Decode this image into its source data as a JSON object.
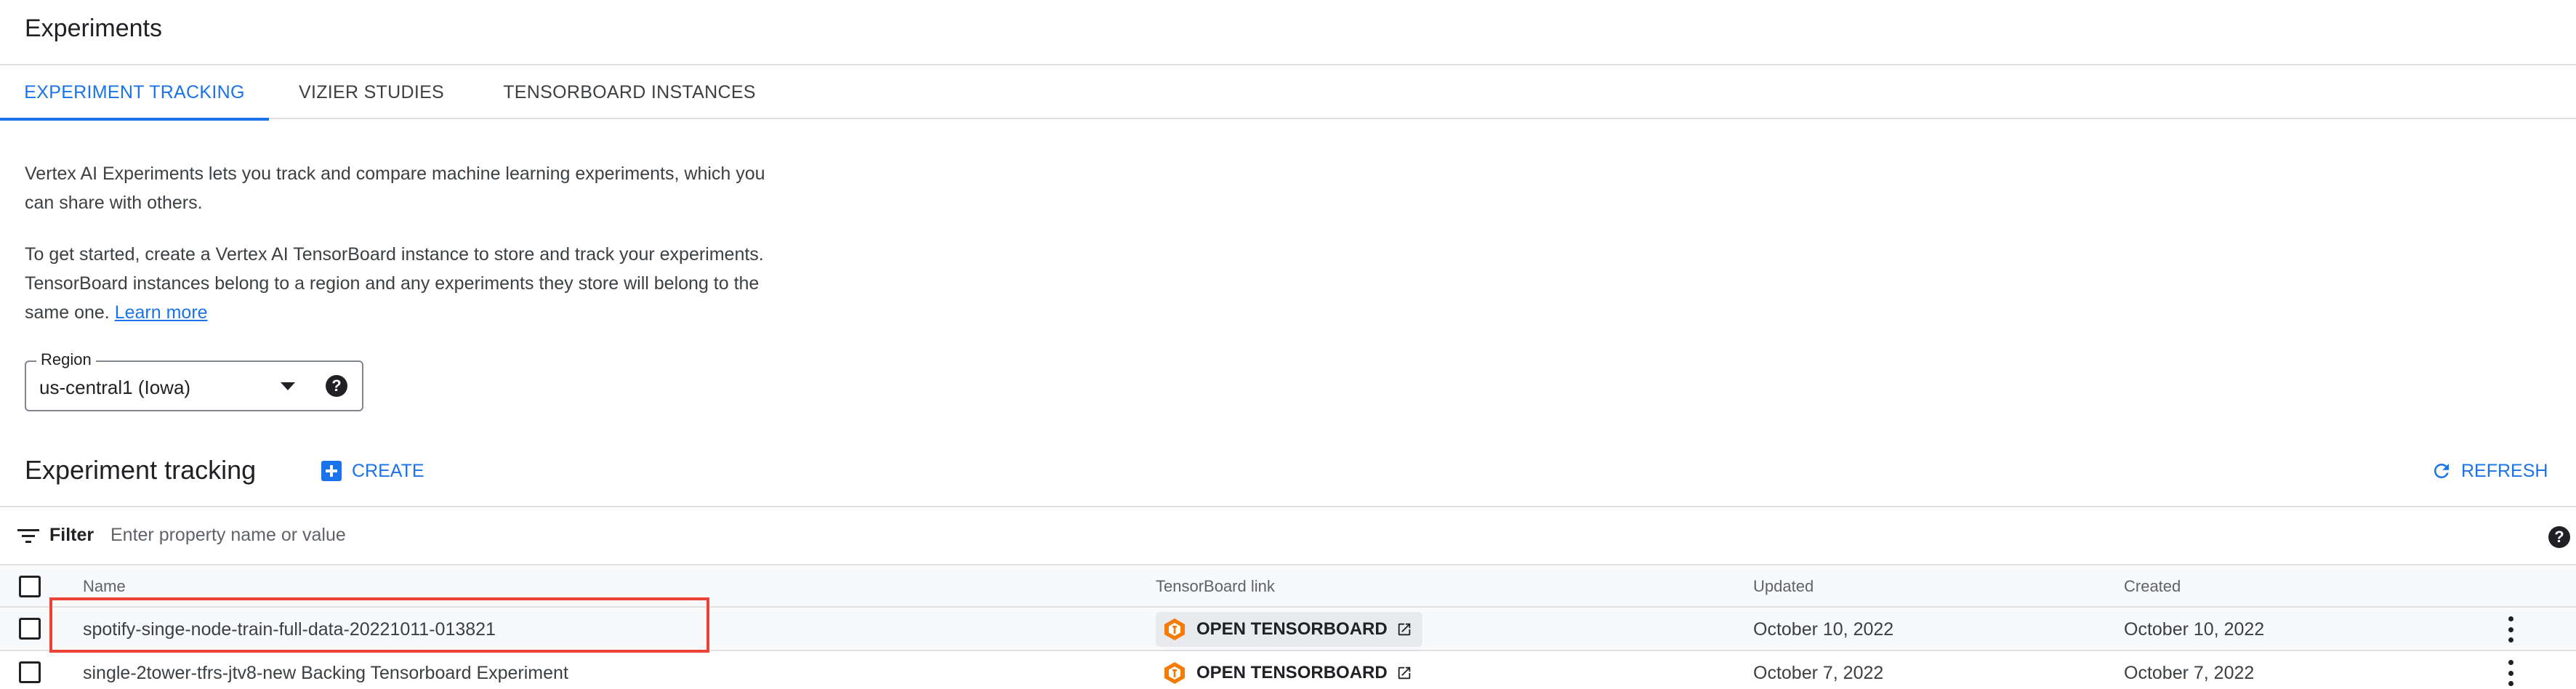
{
  "header": {
    "title": "Experiments"
  },
  "tabs": [
    {
      "label": "EXPERIMENT TRACKING",
      "active": true
    },
    {
      "label": "VIZIER STUDIES",
      "active": false
    },
    {
      "label": "TENSORBOARD INSTANCES",
      "active": false
    }
  ],
  "description": {
    "para1": "Vertex AI Experiments lets you track and compare machine learning experiments, which you can share with others.",
    "para2": "To get started, create a Vertex AI TensorBoard instance to store and track your experiments. TensorBoard instances belong to a region and any experiments they store will belong to the same one.",
    "learn_more": "Learn more"
  },
  "region": {
    "label": "Region",
    "value": "us-central1 (Iowa)"
  },
  "section": {
    "title": "Experiment tracking",
    "create_label": "CREATE",
    "refresh_label": "REFRESH"
  },
  "filter": {
    "label": "Filter",
    "placeholder": "Enter property name or value"
  },
  "table": {
    "columns": {
      "name": "Name",
      "tensorboard": "TensorBoard link",
      "updated": "Updated",
      "created": "Created"
    },
    "rows": [
      {
        "name": "spotify-singe-node-train-full-data-20221011-013821",
        "tensorboard_label": "OPEN TENSORBOARD",
        "updated": "October 10, 2022",
        "created": "October 10, 2022"
      },
      {
        "name": "single-2tower-tfrs-jtv8-new Backing Tensorboard Experiment",
        "tensorboard_label": "OPEN TENSORBOARD",
        "updated": "October 7, 2022",
        "created": "October 7, 2022"
      }
    ]
  },
  "colors": {
    "accent": "#1a73e8",
    "highlight": "#ea4335",
    "tensorboard_logo": "#f57c00"
  },
  "icons": {
    "region_dropdown": "caret-down-icon",
    "help": "question-circle-icon",
    "create": "plus-box-icon",
    "refresh": "refresh-icon",
    "filter": "filter-lines-icon",
    "tensorboard": "tensorboard-logo-icon",
    "external": "external-link-icon",
    "row_menu": "kebab-menu-icon"
  }
}
